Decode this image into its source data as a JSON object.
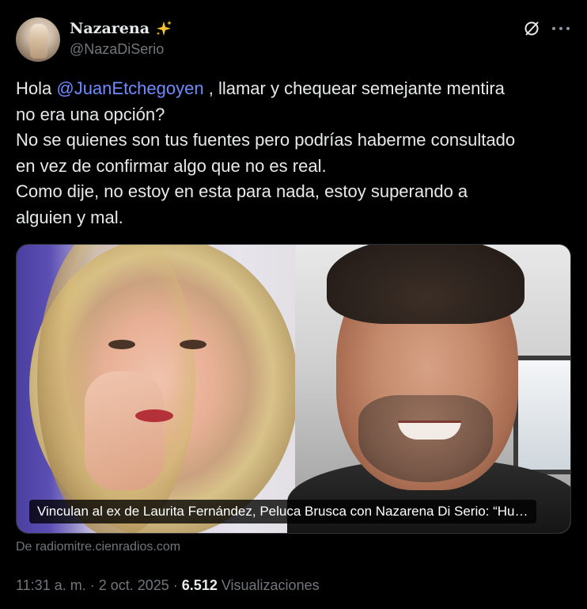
{
  "author": {
    "display_name": "Nazarena",
    "emoji": "✨",
    "handle": "@NazaDiSerio",
    "avatar_icon": "profile-photo"
  },
  "actions": {
    "grok_icon": "grok-icon",
    "more_icon": "more-options-icon"
  },
  "tweet": {
    "line1_pre": "Hola ",
    "mention": "@JuanEtchegoyen",
    "line1_post": " , llamar y chequear semejante mentira",
    "line2": "no era una opción?",
    "line3": "No se quienes son tus fuentes pero podrías haberme consultado",
    "line4": "en vez de confirmar algo que no es real.",
    "line5": "Como dije, no estoy en esta para nada, estoy superando a",
    "line6": "alguien y mal."
  },
  "card": {
    "caption": "Vinculan al ex de Laurita Fernández, Peluca Brusca con Nazarena Di Serio: “Hu…",
    "source": "De radiomitre.cienradios.com"
  },
  "meta": {
    "time": "11:31 a. m.",
    "sep1": " · ",
    "date": "2 oct. 2025",
    "sep2": " · ",
    "views_count": "6.512",
    "views_label": " Visualizaciones"
  },
  "colors": {
    "background": "#000000",
    "text": "#e7e9ea",
    "secondary": "#71767b",
    "mention": "#6e8bff"
  }
}
